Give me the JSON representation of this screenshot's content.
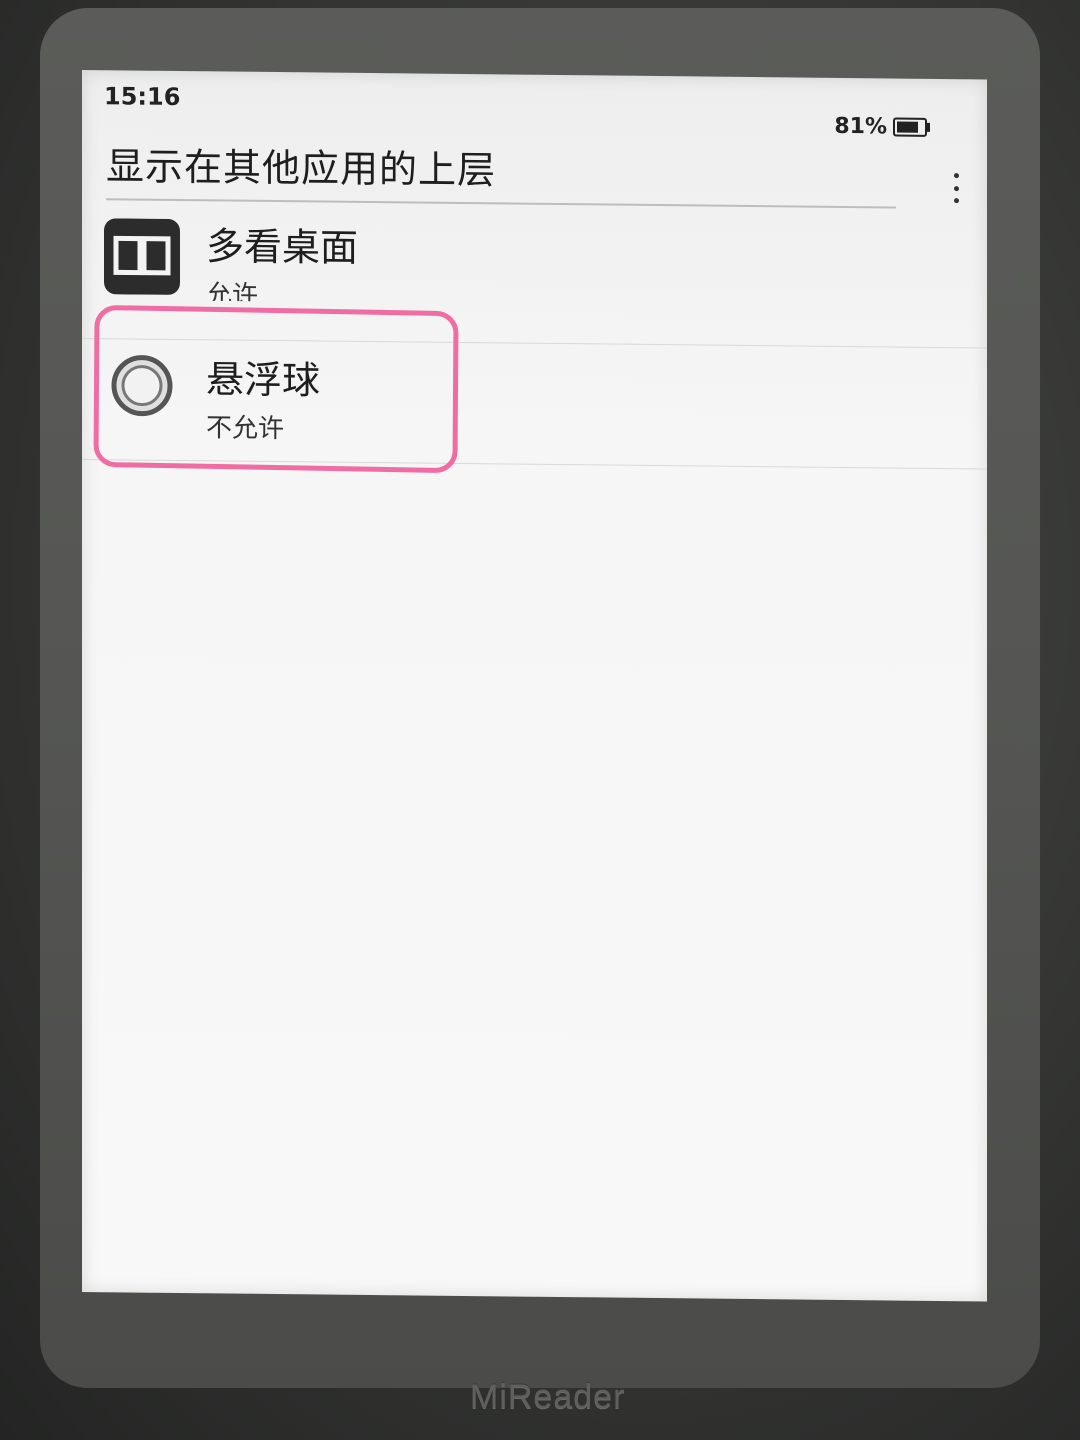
{
  "status_bar": {
    "time": "15:16",
    "battery": "81%"
  },
  "header": {
    "title": "显示在其他应用的上层",
    "more_icon": "more-vert-icon"
  },
  "apps": [
    {
      "name": "多看桌面",
      "status": "允许",
      "icon": "book-icon"
    },
    {
      "name": "悬浮球",
      "status": "不允许",
      "icon": "ring-icon"
    }
  ],
  "device": {
    "brand": "MiReader"
  },
  "colors": {
    "highlight": "#f06da3",
    "screen": "#f6f6f6",
    "bezel": "#555653"
  }
}
